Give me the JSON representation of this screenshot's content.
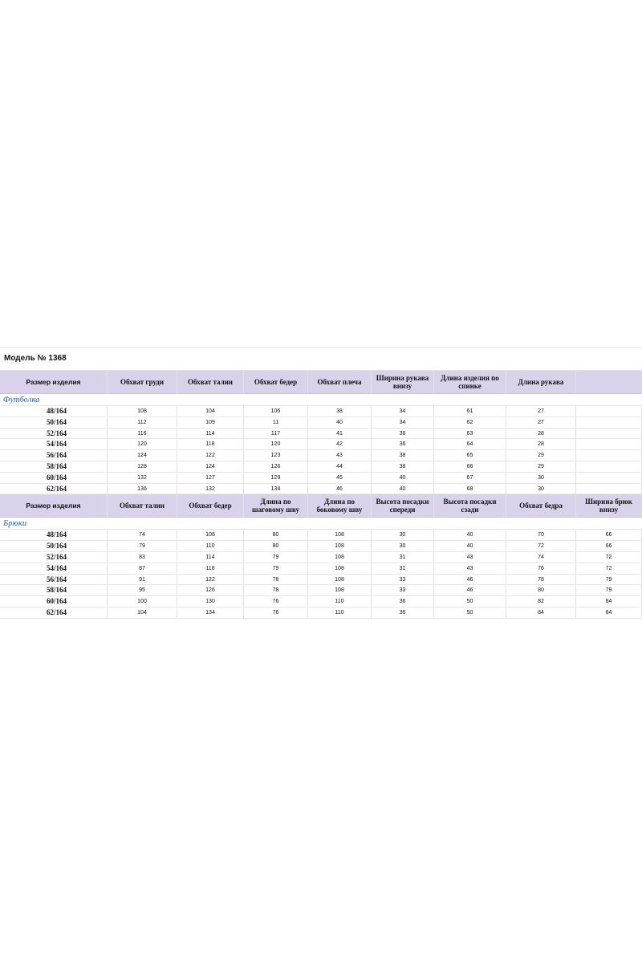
{
  "title": "Модель № 1368",
  "tshirt": {
    "section_label": "Футболка",
    "headers": [
      "Размер изделия",
      "Обхват груди",
      "Обхват талии",
      "Обхват бедер",
      "Обхват плеча",
      "Ширина рукава внизу",
      "Длина изделия по спинке",
      "Длина рукава",
      ""
    ],
    "rows": [
      [
        "48/164",
        "108",
        "104",
        "106",
        "38",
        "34",
        "61",
        "27",
        ""
      ],
      [
        "50/164",
        "112",
        "109",
        "11",
        "40",
        "34",
        "62",
        "27",
        ""
      ],
      [
        "52/164",
        "116",
        "114",
        "117",
        "41",
        "36",
        "63",
        "28",
        ""
      ],
      [
        "54/164",
        "120",
        "118",
        "120",
        "42",
        "36",
        "64",
        "28",
        ""
      ],
      [
        "56/164",
        "124",
        "122",
        "123",
        "43",
        "38",
        "65",
        "29",
        ""
      ],
      [
        "58/164",
        "128",
        "124",
        "126",
        "44",
        "38",
        "66",
        "29",
        ""
      ],
      [
        "60/164",
        "132",
        "127",
        "129",
        "45",
        "40",
        "67",
        "30",
        ""
      ],
      [
        "62/164",
        "136",
        "132",
        "134",
        "46",
        "40",
        "68",
        "30",
        ""
      ]
    ]
  },
  "pants": {
    "section_label": "Брюки",
    "headers": [
      "Размер изделия",
      "Обхват талии",
      "Обхват бедер",
      "Длина по шаговому шву",
      "Длина по боковому шву",
      "Высота посадки спереди",
      "Высота посадки сзади",
      "Обхват бедра",
      "Ширина брюк внизу"
    ],
    "rows": [
      [
        "48/164",
        "74",
        "106",
        "80",
        "108",
        "30",
        "40",
        "70",
        "66"
      ],
      [
        "50/164",
        "79",
        "110",
        "80",
        "108",
        "30",
        "40",
        "72",
        "66"
      ],
      [
        "52/164",
        "83",
        "114",
        "79",
        "108",
        "31",
        "43",
        "74",
        "72"
      ],
      [
        "54/164",
        "87",
        "118",
        "79",
        "108",
        "31",
        "43",
        "76",
        "72"
      ],
      [
        "56/164",
        "91",
        "122",
        "78",
        "108",
        "33",
        "46",
        "78",
        "79"
      ],
      [
        "58/164",
        "95",
        "126",
        "78",
        "108",
        "33",
        "46",
        "80",
        "79"
      ],
      [
        "60/164",
        "100",
        "130",
        "76",
        "110",
        "36",
        "50",
        "82",
        "84"
      ],
      [
        "62/164",
        "104",
        "134",
        "76",
        "110",
        "36",
        "50",
        "84",
        "84"
      ]
    ]
  }
}
